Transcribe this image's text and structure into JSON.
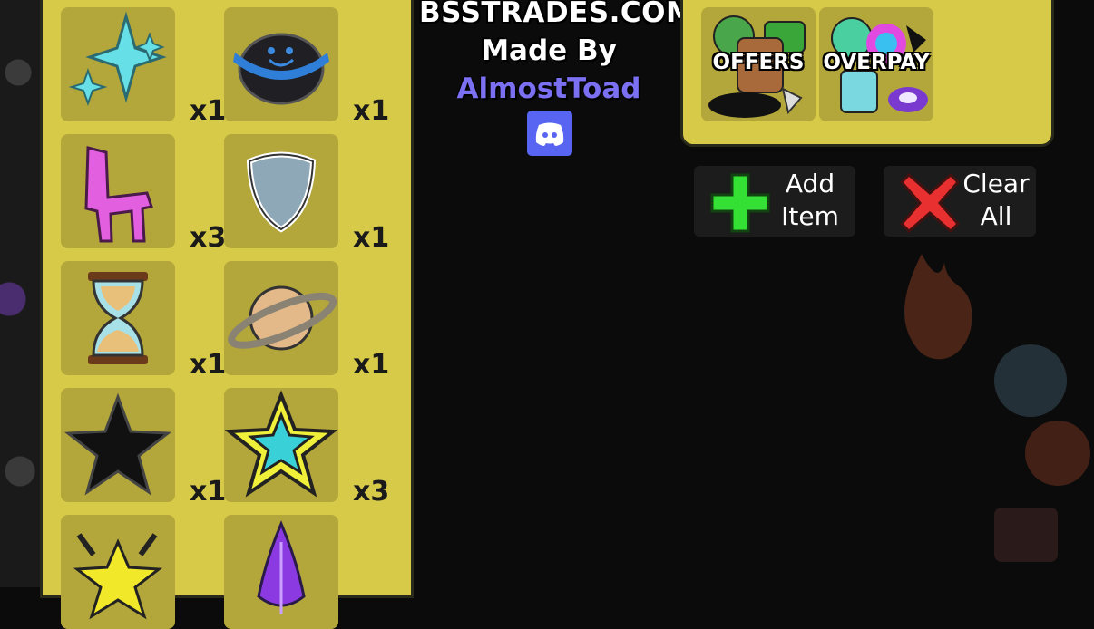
{
  "inventory": {
    "items": [
      {
        "name": "sparkle-icon",
        "count": "x1"
      },
      {
        "name": "planet-blue-face-icon",
        "count": "x1"
      },
      {
        "name": "chair-icon",
        "count": "x3"
      },
      {
        "name": "shield-icon",
        "count": "x1"
      },
      {
        "name": "hourglass-icon",
        "count": "x1"
      },
      {
        "name": "saturn-icon",
        "count": "x1"
      },
      {
        "name": "black-star-icon",
        "count": "x1"
      },
      {
        "name": "cyan-star-icon",
        "count": "x3"
      },
      {
        "name": "yellow-star-icon",
        "count": ""
      },
      {
        "name": "purple-feather-icon",
        "count": ""
      }
    ]
  },
  "credits": {
    "site": "BSSTRADES.COM",
    "made_by": "Made By",
    "author": "AlmostToad"
  },
  "tabs": {
    "offers": "OFFERS",
    "overpay": "OVERPAY"
  },
  "actions": {
    "add_line1": "Add",
    "add_line2": "Item",
    "clear_line1": "Clear",
    "clear_line2": "All"
  },
  "colors": {
    "panel": "#d7ca48",
    "slot": "#b3a63a",
    "author": "#7b6ff2",
    "discord": "#5865f2"
  }
}
